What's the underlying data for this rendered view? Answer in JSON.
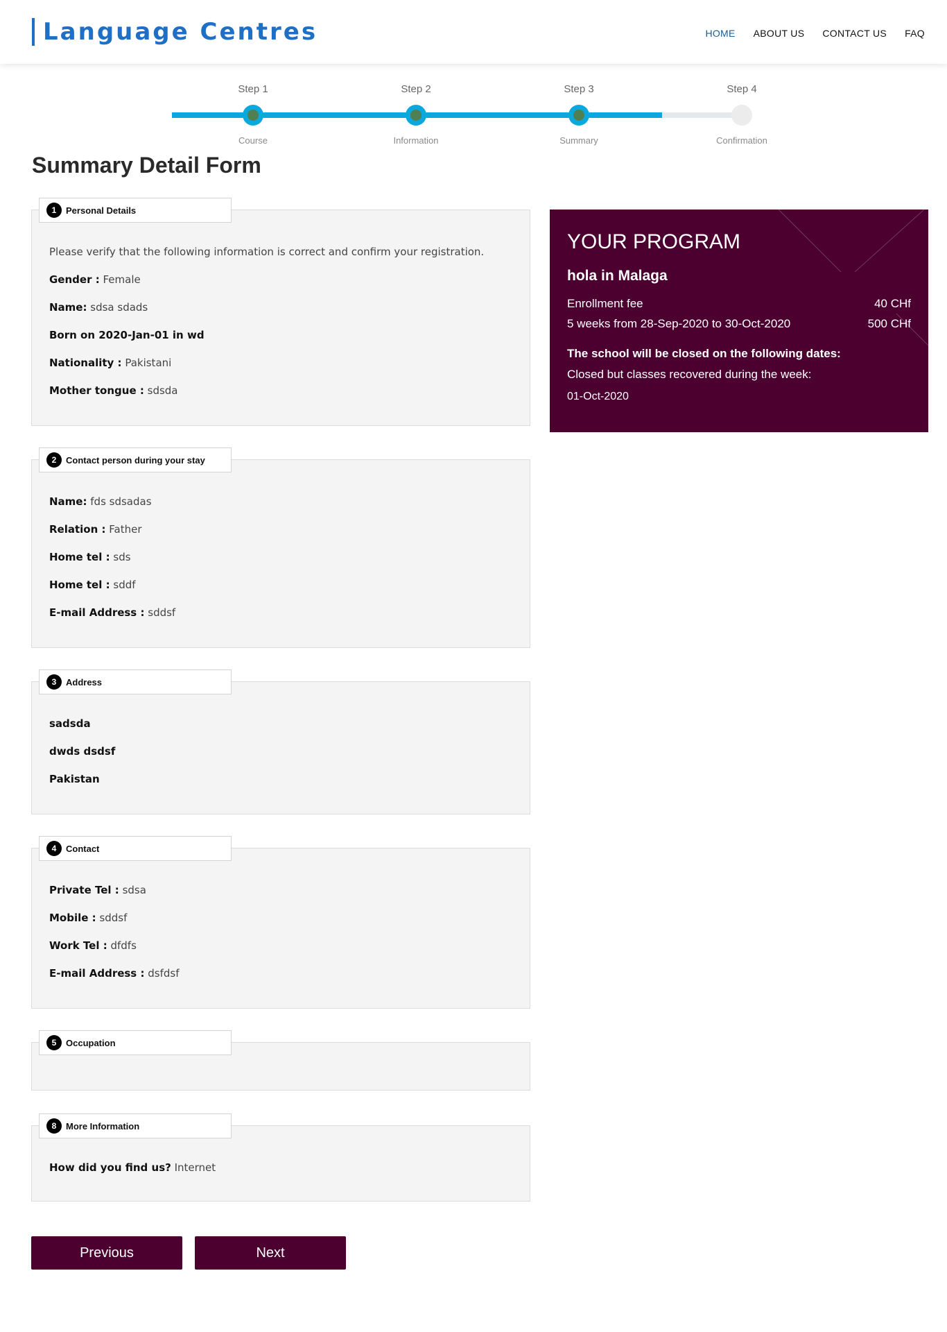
{
  "header": {
    "logo": "Language Centres",
    "nav": [
      {
        "label": "HOME",
        "active": true
      },
      {
        "label": "ABOUT US",
        "active": false
      },
      {
        "label": "CONTACT US",
        "active": false
      },
      {
        "label": "FAQ",
        "active": false
      }
    ]
  },
  "steps": {
    "progress_percent": 86,
    "items": [
      {
        "label": "Step 1",
        "caption": "Course",
        "done": true
      },
      {
        "label": "Step 2",
        "caption": "Information",
        "done": true
      },
      {
        "label": "Step 3",
        "caption": "Summary",
        "done": true
      },
      {
        "label": "Step 4",
        "caption": "Confirmation",
        "done": false
      }
    ]
  },
  "page_title": "Summary Detail Form",
  "personal": {
    "number": "1",
    "title": "Personal Details",
    "intro": "Please verify that the following information is correct and confirm your registration.",
    "gender_label": "Gender :",
    "gender": "Female",
    "name_label": "Name:",
    "name": "sdsa sdads",
    "born": "Born on 2020-Jan-01 in wd",
    "nationality_label": "Nationality :",
    "nationality": "Pakistani",
    "mother_tongue_label": "Mother tongue :",
    "mother_tongue": "sdsda"
  },
  "contact_person": {
    "number": "2",
    "title": "Contact person during your stay",
    "name_label": "Name:",
    "name": "fds sdsadas",
    "relation_label": "Relation :",
    "relation": "Father",
    "home_tel_label": "Home tel :",
    "home_tel": "sds",
    "home_tel2_label": "Home tel :",
    "home_tel2": "sddf",
    "email_label": "E-mail Address :",
    "email": "sddsf"
  },
  "address": {
    "number": "3",
    "title": "Address",
    "line1": "sadsda",
    "line2": "dwds dsdsf",
    "line3": "Pakistan"
  },
  "contact": {
    "number": "4",
    "title": "Contact",
    "private_tel_label": "Private Tel :",
    "private_tel": "sdsa",
    "mobile_label": "Mobile :",
    "mobile": "sddsf",
    "work_tel_label": "Work Tel :",
    "work_tel": "dfdfs",
    "email_label": "E-mail Address :",
    "email": "dsfdsf"
  },
  "occupation": {
    "number": "5",
    "title": "Occupation"
  },
  "more_info": {
    "number": "8",
    "title": "More Information",
    "find_label": "How did you find us?",
    "find": "Internet"
  },
  "program": {
    "title": "YOUR PROGRAM",
    "course": "hola in Malaga",
    "fee_label": "Enrollment fee",
    "fee": "40 CHf",
    "duration": "5 weeks from 28-Sep-2020 to 30-Oct-2020",
    "duration_price": "500 CHf",
    "closed_notice": "The school will be closed on the following dates:",
    "closed_note": "Closed but classes recovered during the week:",
    "closed_date": "01-Oct-2020"
  },
  "buttons": {
    "previous": "Previous",
    "next": "Next"
  },
  "colors": {
    "brand_blue": "#1f6fc4",
    "step_blue": "#0aa8dc",
    "program_bg": "#4b0030",
    "panel_bg": "#f4f4f4"
  }
}
